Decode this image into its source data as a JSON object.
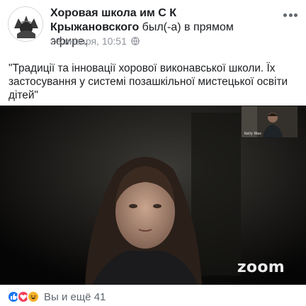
{
  "post": {
    "page_name": "Хоровая школа им С К Крыжановского",
    "action_text": "был(-а) в прямом эфире.",
    "timestamp": "23 января, 10:51",
    "privacy_icon": "globe-icon",
    "text": "\"Традиції та інновації хорової виконавської школи. Їх застосування у системі позашкільної мистецької освіти дітей\""
  },
  "video": {
    "thumbnail_name": "Kelly Wax",
    "logo": "zoom"
  },
  "reactions": {
    "icons": [
      "like-icon",
      "love-icon",
      "haha-icon"
    ],
    "summary": "Вы и ещё 41"
  },
  "colors": {
    "like": "#1877f2",
    "love": "#f33e58",
    "haha": "#f7b125",
    "muted": "#90949c"
  }
}
